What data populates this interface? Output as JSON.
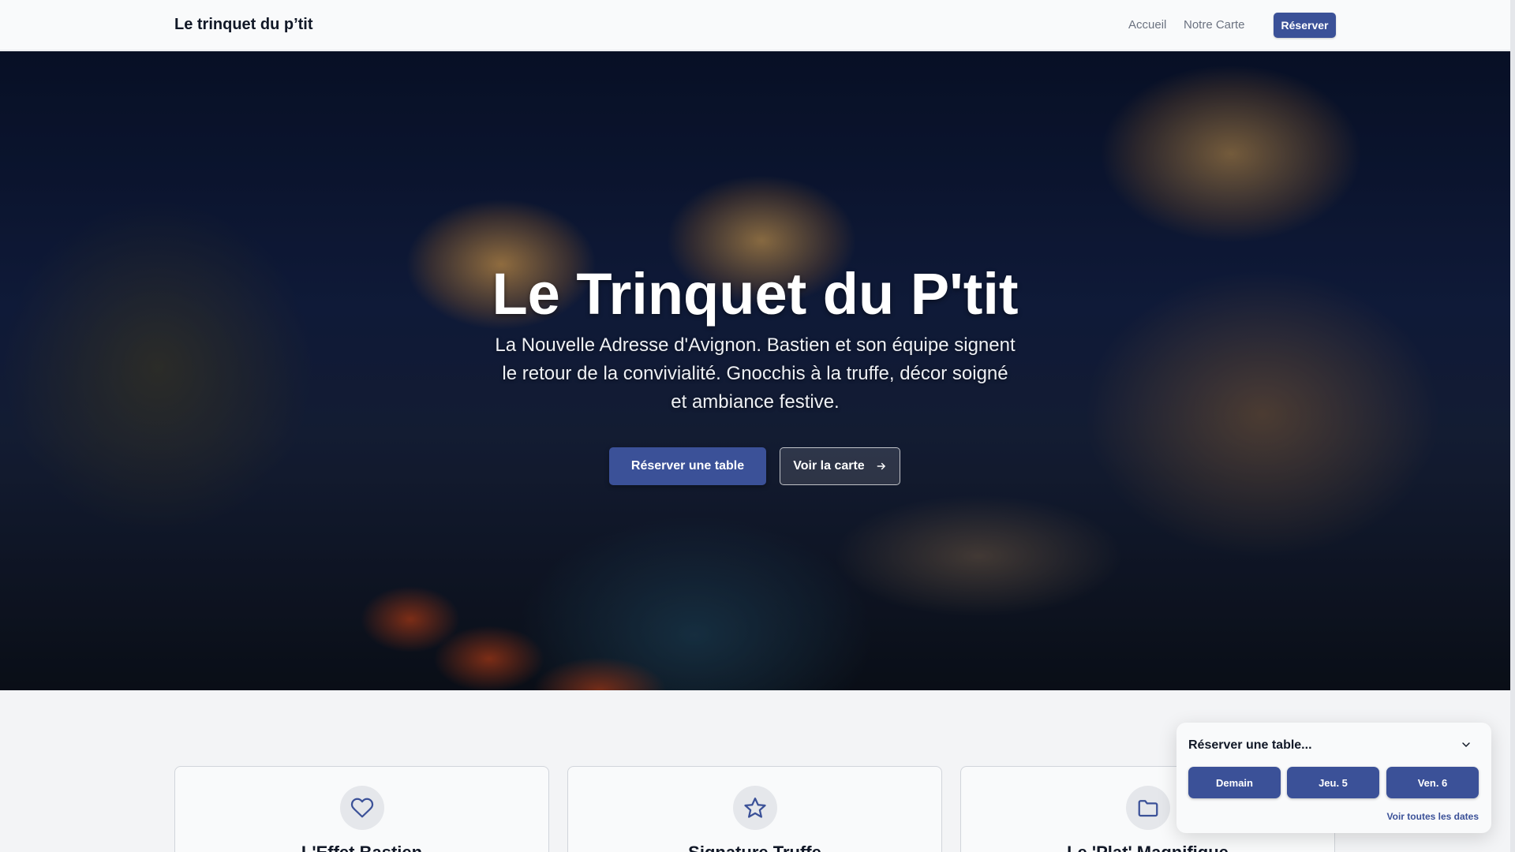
{
  "header": {
    "brand": "Le trinquet du p’tit",
    "nav": {
      "home": "Accueil",
      "menu": "Notre Carte",
      "book": "Réserver"
    }
  },
  "hero": {
    "title": "Le Trinquet du P'tit",
    "subtitle": "La Nouvelle Adresse d'Avignon. Bastien et son équipe signent le retour de la convivialité. Gnocchis à la truffe, décor soigné et ambiance festive.",
    "primary_button": "Réserver une table",
    "secondary_button": "Voir la carte",
    "secondary_icon": "arrow-right-icon"
  },
  "features": [
    {
      "icon": "heart-icon",
      "title": "L'Effet Bastien"
    },
    {
      "icon": "star-icon",
      "title": "Signature Truffe"
    },
    {
      "icon": "folder-icon",
      "title": "Le 'Plat' Magnifique"
    }
  ],
  "booking_widget": {
    "title": "Réserver une table...",
    "dates": [
      "Demain",
      "Jeu. 5",
      "Ven. 6"
    ],
    "all_dates_link": "Voir toutes les dates"
  },
  "colors": {
    "accent": "#3b5198",
    "page_bg": "#f3f4f6",
    "header_bg": "#f9fafb",
    "text_dark": "#111827",
    "text_muted": "#6b7280"
  }
}
